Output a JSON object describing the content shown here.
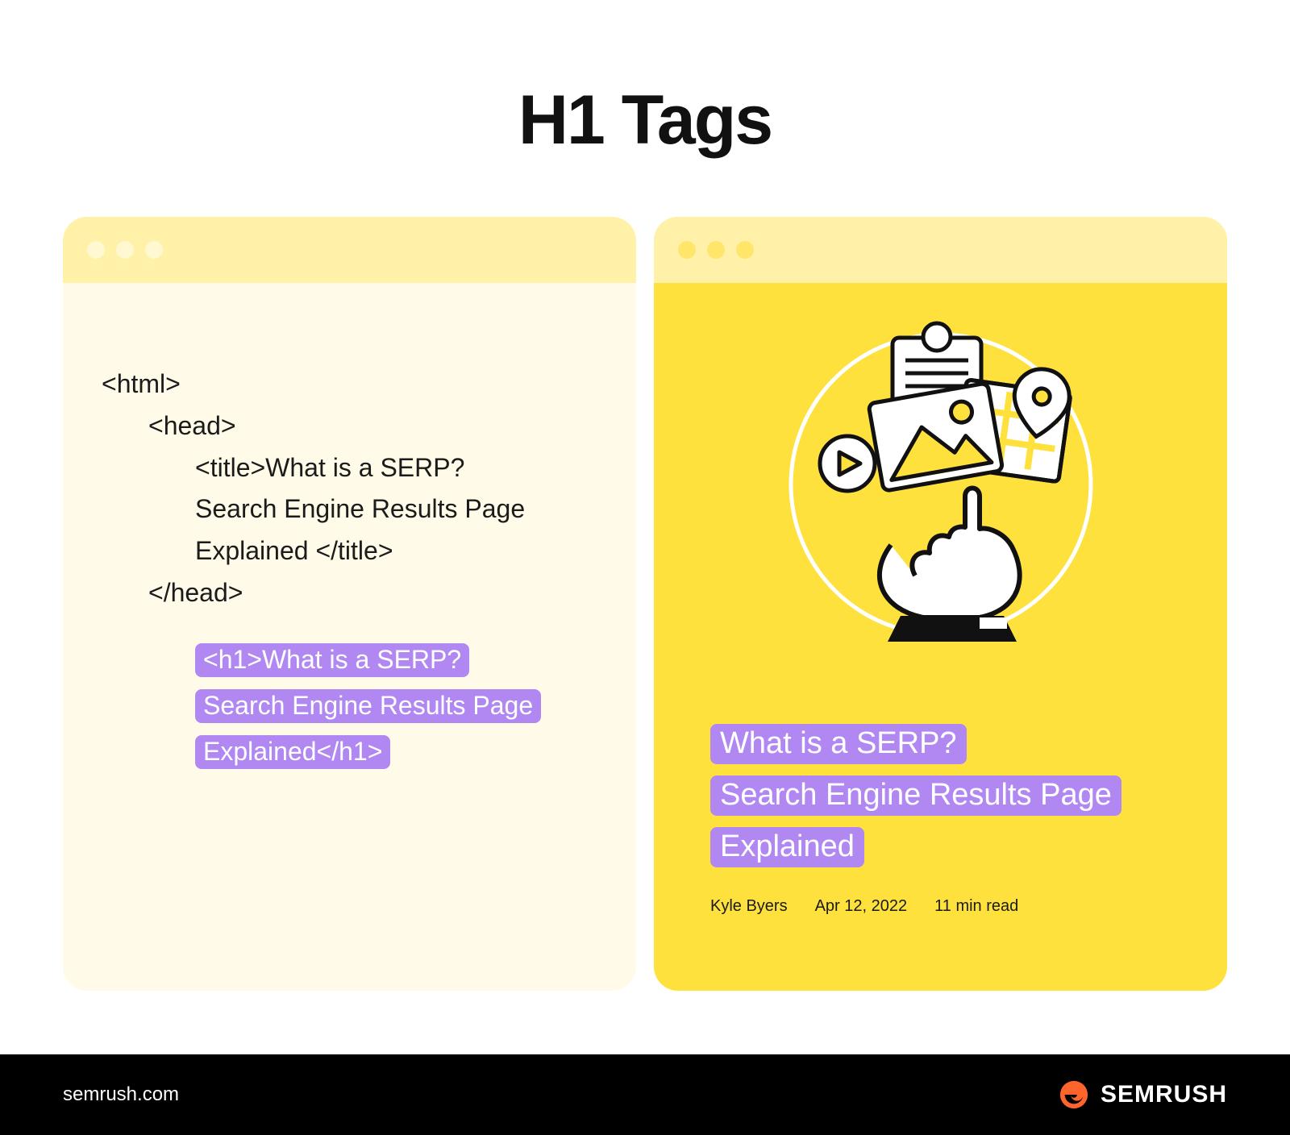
{
  "title": "H1 Tags",
  "code": {
    "html_open": "<html>",
    "head_open": "<head>",
    "title_line1": "<title>What is a SERP?",
    "title_line2": "Search Engine Results Page",
    "title_line3": "Explained </title>",
    "head_close": "</head>",
    "h1_highlight": "<h1>What is a SERP?\nSearch Engine Results Page\nExplained</h1>"
  },
  "article": {
    "headline": "What is a SERP?\nSearch Engine Results Page\nExplained",
    "author": "Kyle Byers",
    "date": "Apr 12, 2022",
    "read_time": "11 min read"
  },
  "footer": {
    "url": "semrush.com",
    "brand": "SEMRUSH"
  }
}
